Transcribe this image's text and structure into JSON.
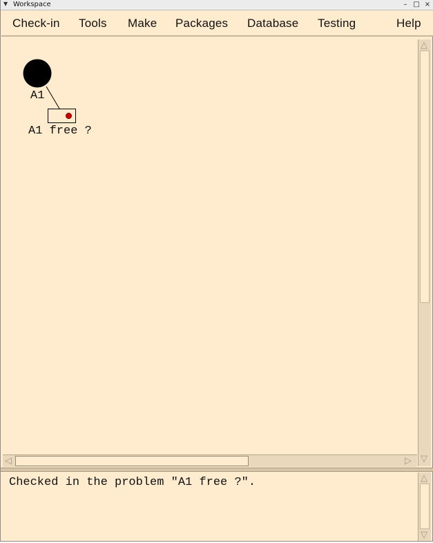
{
  "window": {
    "title": "Workspace",
    "menu_arrow_icon": "triangle-down-icon",
    "minimize_glyph": "–",
    "maximize_glyph": "□",
    "close_glyph": "×"
  },
  "menubar": {
    "items": [
      {
        "label": "Check-in"
      },
      {
        "label": "Tools"
      },
      {
        "label": "Make"
      },
      {
        "label": "Packages"
      },
      {
        "label": "Database"
      },
      {
        "label": "Testing"
      },
      {
        "label": "Help"
      }
    ]
  },
  "workspace": {
    "node": {
      "label": "A1",
      "color": "#000000"
    },
    "problem": {
      "label": "A1 free ?",
      "marker_color": "#cc0000"
    }
  },
  "console": {
    "message": "Checked in the problem \"A1 free ?\"."
  },
  "colors": {
    "background": "#ffebcd",
    "scroll_track": "#ead8bc"
  }
}
